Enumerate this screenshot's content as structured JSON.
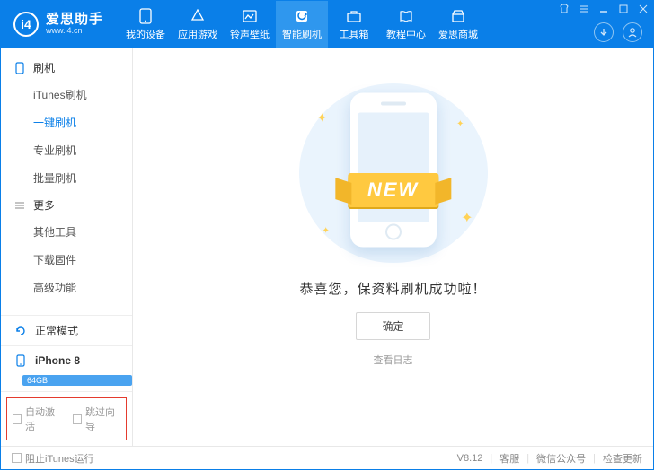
{
  "header": {
    "brand": "爱思助手",
    "site": "www.i4.cn",
    "nav": [
      {
        "label": "我的设备"
      },
      {
        "label": "应用游戏"
      },
      {
        "label": "铃声壁纸"
      },
      {
        "label": "智能刷机"
      },
      {
        "label": "工具箱"
      },
      {
        "label": "教程中心"
      },
      {
        "label": "爱思商城"
      }
    ]
  },
  "sidebar": {
    "group_flash": "刷机",
    "flash_items": [
      "iTunes刷机",
      "一键刷机",
      "专业刷机",
      "批量刷机"
    ],
    "group_more": "更多",
    "more_items": [
      "其他工具",
      "下载固件",
      "高级功能"
    ],
    "mode_label": "正常模式",
    "device_name": "iPhone 8",
    "storage": "64GB",
    "auto_activate": "自动激活",
    "skip_guide": "跳过向导"
  },
  "main": {
    "ribbon": "NEW",
    "congrats": "恭喜您，保资料刷机成功啦！",
    "ok": "确定",
    "view_log": "查看日志"
  },
  "footer": {
    "block_itunes": "阻止iTunes运行",
    "version": "V8.12",
    "support": "客服",
    "wechat": "微信公众号",
    "update": "检查更新"
  }
}
